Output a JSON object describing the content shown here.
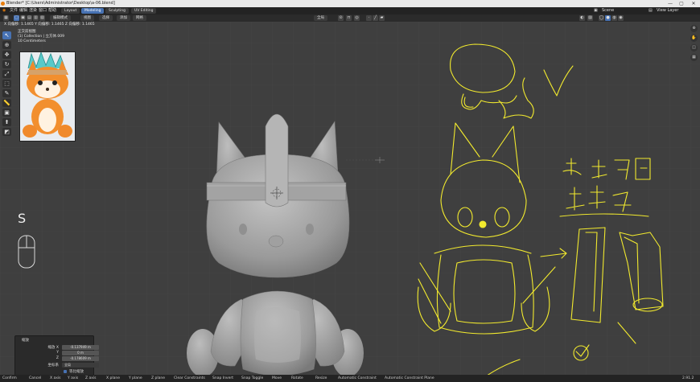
{
  "window": {
    "title": "Blender* [C:\\Users\\Administrator\\Desktop\\a-06.blend]",
    "controls": [
      "—",
      "▢",
      "✕"
    ]
  },
  "menu": {
    "items": [
      "文件",
      "编辑",
      "渲染",
      "窗口",
      "帮助"
    ],
    "workspaces": [
      "Layout",
      "Modeling",
      "Sculpting",
      "UV Editing"
    ],
    "active_workspace_label": "Modeling",
    "scene_label": "Scene",
    "view_layer_label": "View Layer"
  },
  "header": {
    "mode_label": "编辑模式",
    "view_label": "视图",
    "select_label": "选择",
    "add_label": "添加",
    "mesh_label": "网格",
    "transform_label": "全局",
    "snap_label": "吸附"
  },
  "viewport": {
    "info_line": "X 向偏移: 1.1465   Y 向偏移: 1.1465   Z 向偏移: 1.1465",
    "view_name": "正交前视图",
    "collection": "(1) Collection | 立方体.009",
    "units": "10 Centimeters",
    "key_pressed": "S"
  },
  "redo_panel": {
    "title": "缩放",
    "rows": [
      {
        "label": "缩放 X",
        "value": "-0.137949 m"
      },
      {
        "label": "Y",
        "value": "0 m"
      },
      {
        "label": "Z",
        "value": "-0.178609 m"
      }
    ],
    "orientation_label": "坐标系",
    "orientation_value": "全局",
    "option_label": "等比缩放"
  },
  "statusbar": {
    "items": [
      "Confirm",
      "Cancel",
      "X axis",
      "Y axis",
      "Z axis",
      "X plane",
      "Y plane",
      "Z plane",
      "Clear Constraints",
      "Snap Invert",
      "Snap Toggle",
      "Move",
      "Rotate",
      "Resize",
      "Automatic Constraint",
      "Automatic Constraint Plane"
    ],
    "version": "2.91.2"
  },
  "colors": {
    "accent": "#4772b3",
    "sketch": "#f2ea2e",
    "model": "#a8a8a8",
    "viewport_bg": "#3f3f3f"
  },
  "icons": [
    "cursor-icon",
    "move-icon",
    "rotate-icon",
    "scale-icon",
    "transform-icon",
    "annotate-icon",
    "measure-icon",
    "add-cube-icon",
    "extrude-icon",
    "inset-icon",
    "bevel-icon",
    "loopcut-icon",
    "knife-icon",
    "polybuild-icon",
    "spin-icon",
    "smooth-icon",
    "shear-icon",
    "rip-icon"
  ]
}
